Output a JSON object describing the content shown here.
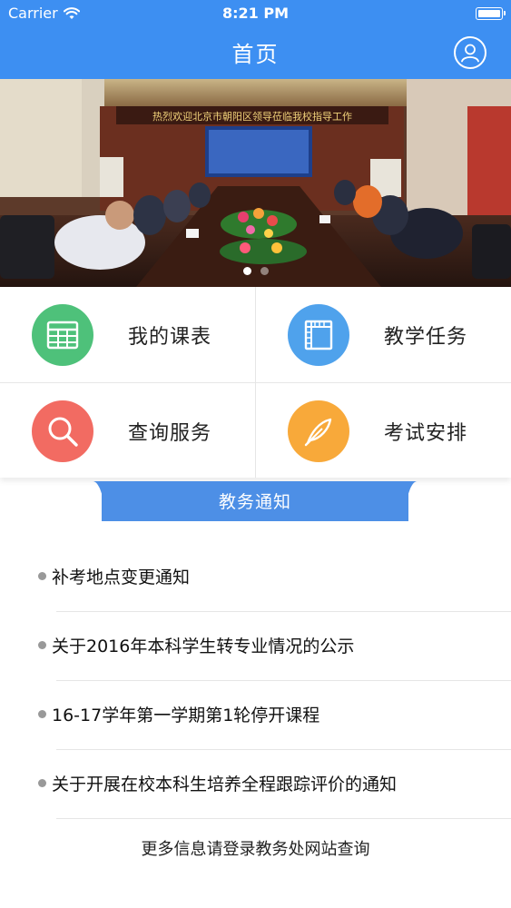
{
  "status_bar": {
    "carrier": "Carrier",
    "time": "8:21 PM",
    "battery_level": 1.0
  },
  "nav": {
    "title": "首页",
    "profile_icon": "user-circle-icon"
  },
  "banner": {
    "sign_text": "热烈欢迎北京市朝阳区领导莅临我校指导工作",
    "slide_count": 2,
    "active_slide": 1
  },
  "menu": [
    {
      "label": "我的课表",
      "icon": "calendar-grid-icon",
      "color": "#4ec17a"
    },
    {
      "label": "教学任务",
      "icon": "notebook-icon",
      "color": "#4fa2ec"
    },
    {
      "label": "查询服务",
      "icon": "search-icon",
      "color": "#f26b62"
    },
    {
      "label": "考试安排",
      "icon": "feather-pen-icon",
      "color": "#f8a93a"
    }
  ],
  "notices": {
    "title": "教务通知",
    "items": [
      "补考地点变更通知",
      "关于2016年本科学生转专业情况的公示",
      "16-17学年第一学期第1轮停开课程",
      "关于开展在校本科生培养全程跟踪评价的通知"
    ],
    "footer": "更多信息请登录教务处网站查询"
  },
  "colors": {
    "primary": "#3d8ff2",
    "tab": "#4d8fe6"
  }
}
